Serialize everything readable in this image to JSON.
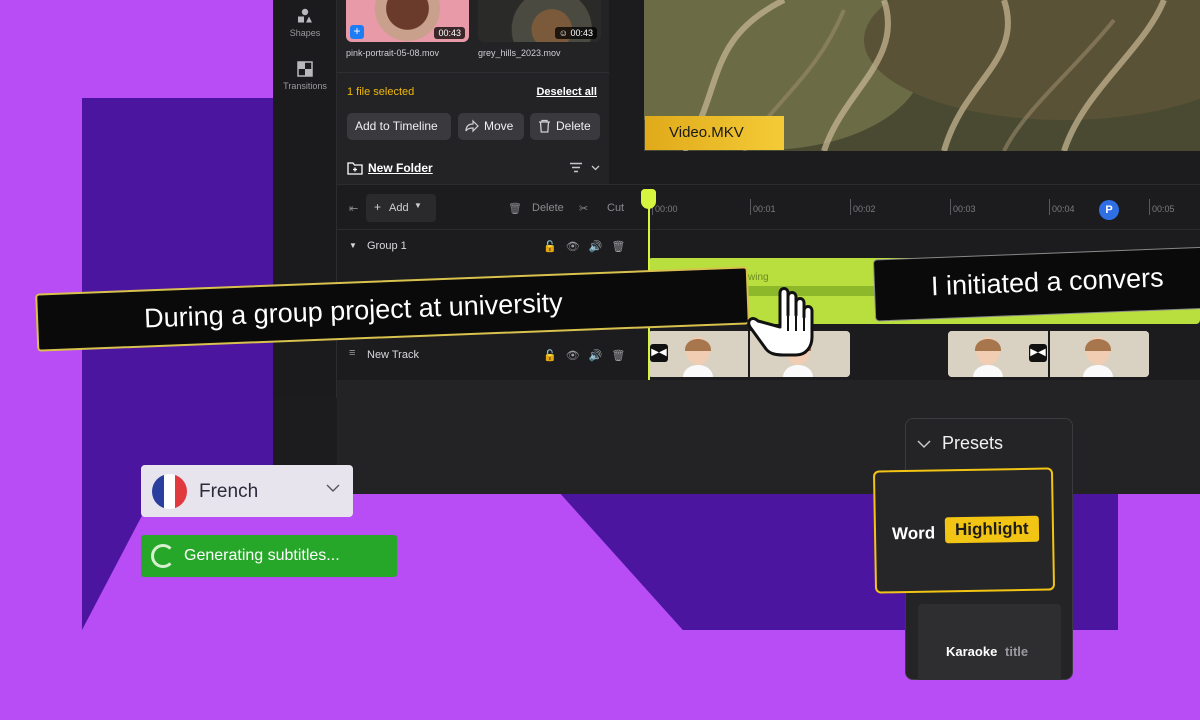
{
  "sidebar": {
    "items": [
      {
        "label": "Shapes",
        "icon": "shapes-icon"
      },
      {
        "label": "Transitions",
        "icon": "transitions-icon"
      }
    ]
  },
  "media": {
    "files": [
      {
        "name": "pink-portrait-05-08.mov",
        "duration": "00:43"
      },
      {
        "name": "grey_hills_2023.mov",
        "duration": "00:43"
      }
    ],
    "selection_text": "1 file selected",
    "deselect_label": "Deselect all",
    "actions": {
      "add_to_timeline": "Add to Timeline",
      "move": "Move",
      "delete": "Delete"
    },
    "new_folder": "New Folder"
  },
  "preview": {
    "video_label": "Video.MKV"
  },
  "toolbar": {
    "add": "Add",
    "delete": "Delete",
    "cut": "Cut",
    "marker": "P"
  },
  "timeline": {
    "ticks": [
      "00:00",
      "00:01",
      "00:02",
      "00:03",
      "00:04",
      "00:05"
    ],
    "tracks": [
      {
        "name": "Group 1"
      },
      {
        "name": "New Track"
      }
    ],
    "clip_label": "wing"
  },
  "subtitles": {
    "line1": "During a group project at university",
    "line2": "I initiated a convers"
  },
  "language": {
    "name": "French",
    "flag_colors": [
      "#2a3f9d",
      "#ffffff",
      "#e03a3e"
    ]
  },
  "status": {
    "text": "Generating subtitles..."
  },
  "presets": {
    "title": "Presets",
    "word_preset": {
      "word": "Word",
      "highlight": "Highlight"
    },
    "karaoke_preset": {
      "word": "Karaoke",
      "title": "title"
    }
  },
  "colors": {
    "accent_yellow": "#f2c413",
    "playhead": "#d6f53f",
    "status_green": "#27a72a",
    "background": "#b84cf5"
  }
}
